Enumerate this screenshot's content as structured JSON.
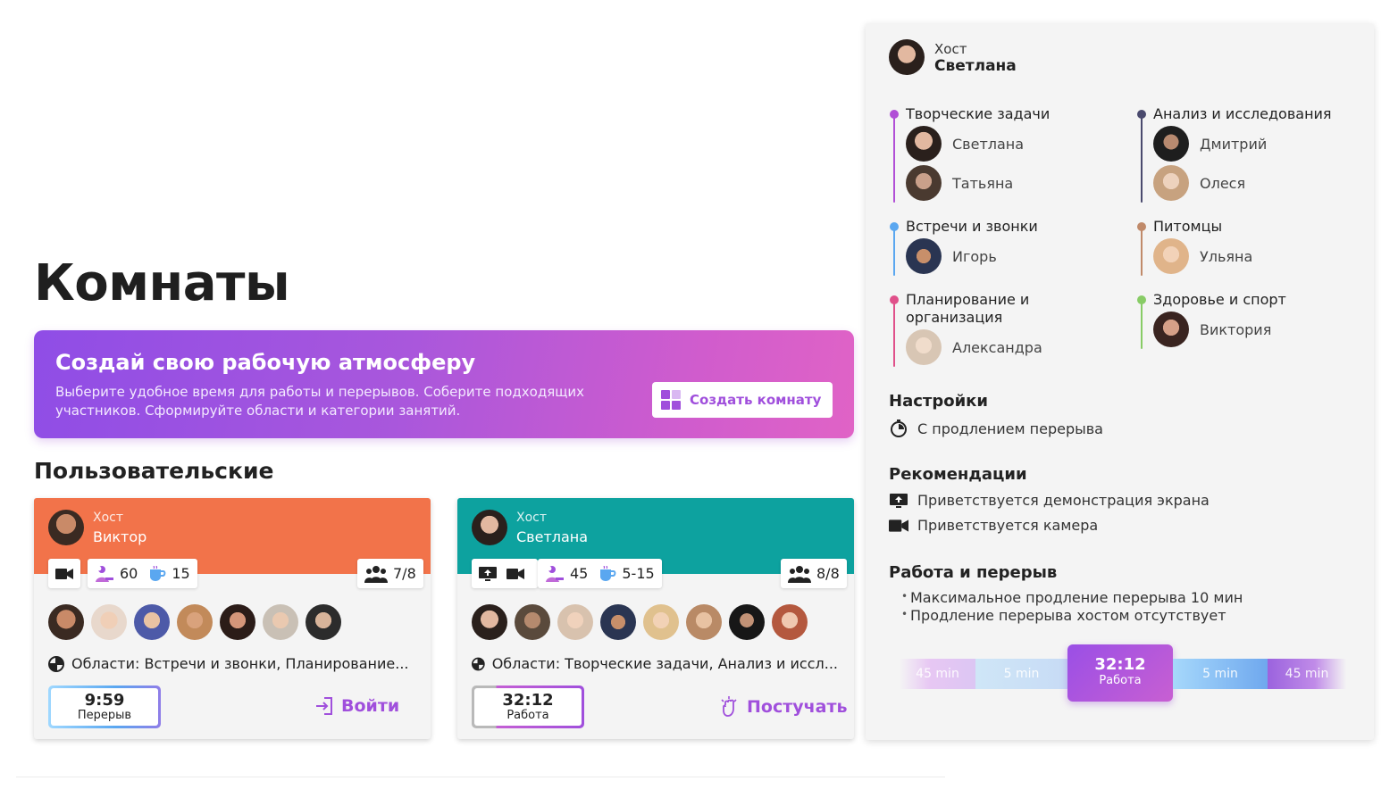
{
  "page": {
    "title": "Комнаты"
  },
  "promo": {
    "title": "Создай свою рабочую атмосферу",
    "text": "Выберите удобное время для работы и перерывов. Соберите подходящих участников. Сформируйте области и категории занятий.",
    "button_label": "Создать комнату"
  },
  "section": {
    "title": "Пользовательские"
  },
  "rooms": [
    {
      "header_color": "#f2734a",
      "host_label": "Хост",
      "host_name": "Виктор",
      "icons": [
        "camera-icon"
      ],
      "work_count": "60",
      "break_count": "15",
      "capacity": "7/8",
      "avatar_colors": [
        "#3a2a22",
        "#e8d8cc",
        "#4d5aa8",
        "#c28a5a",
        "#2b1c18",
        "#c9c0b5",
        "#2c2c2c"
      ],
      "areas": "Области: Встречи и звонки, Планирование...",
      "timer": {
        "time": "9:59",
        "label": "Перерыв"
      },
      "action_label": "Войти"
    },
    {
      "header_color": "#0da29f",
      "host_label": "Хост",
      "host_name": "Светлана",
      "icons": [
        "screen-share-icon",
        "camera-icon"
      ],
      "work_count": "45",
      "break_count": "5-15",
      "capacity": "8/8",
      "avatar_colors": [
        "#2a201c",
        "#5a4a3c",
        "#d8c2ae",
        "#2a3552",
        "#e0c18e",
        "#b98a66",
        "#171717",
        "#b4583e"
      ],
      "areas": "Области: Творческие задачи, Анализ и иссл...",
      "timer": {
        "time": "32:12",
        "label": "Работа"
      },
      "action_label": "Постучать"
    }
  ],
  "panel": {
    "host_label": "Хост",
    "host_name": "Светлана",
    "categories": [
      {
        "name": "Творческие задачи",
        "color": "#b14fd6",
        "members": [
          "Светлана",
          "Татьяна"
        ],
        "avatar_colors": [
          "#2a201c",
          "#4a3a30"
        ]
      },
      {
        "name": "Анализ и исследования",
        "color": "#4a4a6e",
        "members": [
          "Дмитрий",
          "Олеся"
        ],
        "avatar_colors": [
          "#1e1e1e",
          "#c7a27f"
        ]
      },
      {
        "name": "Встречи и звонки",
        "color": "#5aa7f0",
        "members": [
          "Игорь"
        ],
        "avatar_colors": [
          "#2a3552"
        ]
      },
      {
        "name": "Питомцы",
        "color": "#c08a6a",
        "members": [
          "Ульяна"
        ],
        "avatar_colors": [
          "#e0b48a"
        ]
      },
      {
        "name": "Планирование и организация",
        "color": "#e0508a",
        "members": [
          "Александра"
        ],
        "avatar_colors": [
          "#d8c6b4"
        ]
      },
      {
        "name": "Здоровье и спорт",
        "color": "#88cc66",
        "members": [
          "Виктория"
        ],
        "avatar_colors": [
          "#3a2420"
        ]
      }
    ],
    "settings": {
      "title": "Настройки",
      "items": [
        "С продлением перерыва"
      ]
    },
    "recommendations": {
      "title": "Рекомендации",
      "items": [
        "Приветствуется демонстрация экрана",
        "Приветствуется камера"
      ]
    },
    "work_break": {
      "title": "Работа и перерыв",
      "items": [
        "Максимальное продление перерыва 10 мин",
        "Продление перерыва хостом отсутствует"
      ],
      "schedule": [
        {
          "label": "45 min",
          "kind": "work"
        },
        {
          "label": "5 min",
          "kind": "break"
        },
        {
          "label": "32:12",
          "sub": "Работа",
          "kind": "current"
        },
        {
          "label": "5 min",
          "kind": "break"
        },
        {
          "label": "45 min",
          "kind": "work"
        }
      ]
    }
  },
  "colors": {
    "accent": "#a04fdc",
    "orange": "#f2734a",
    "teal": "#0da29f"
  }
}
